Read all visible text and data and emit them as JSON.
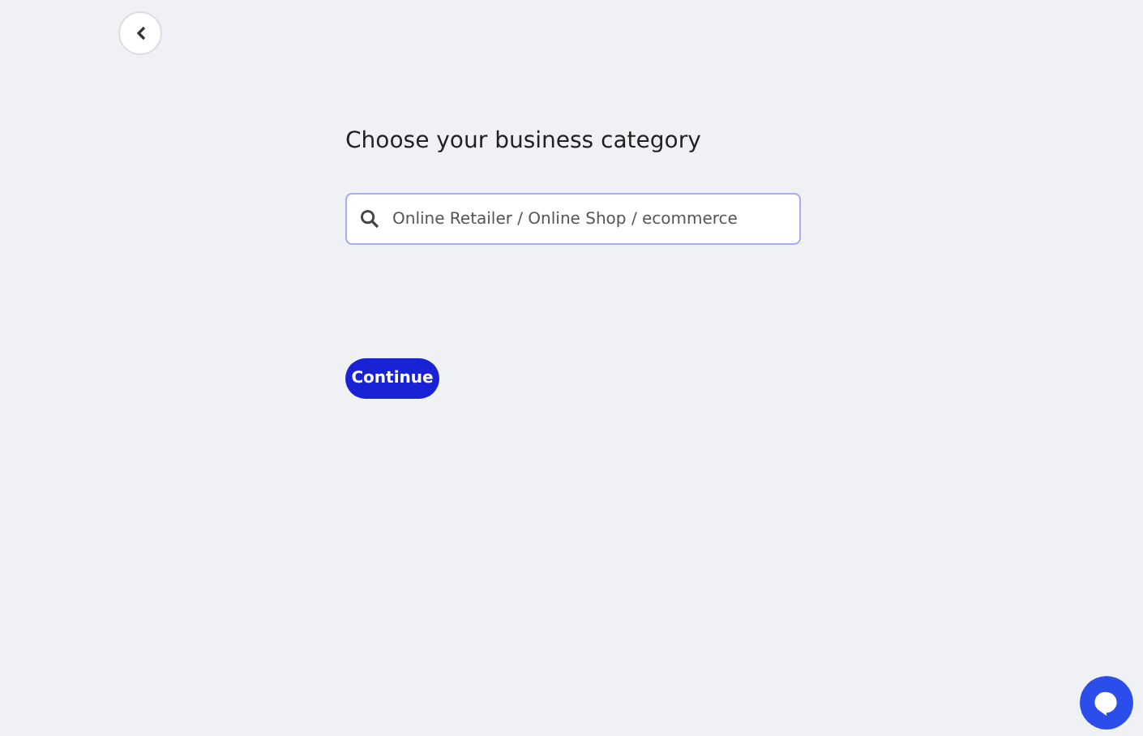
{
  "title": "Choose your business category",
  "search": {
    "value": "Online Retailer / Online Shop / ecommerce"
  },
  "continue_button": {
    "label": "Continue"
  }
}
